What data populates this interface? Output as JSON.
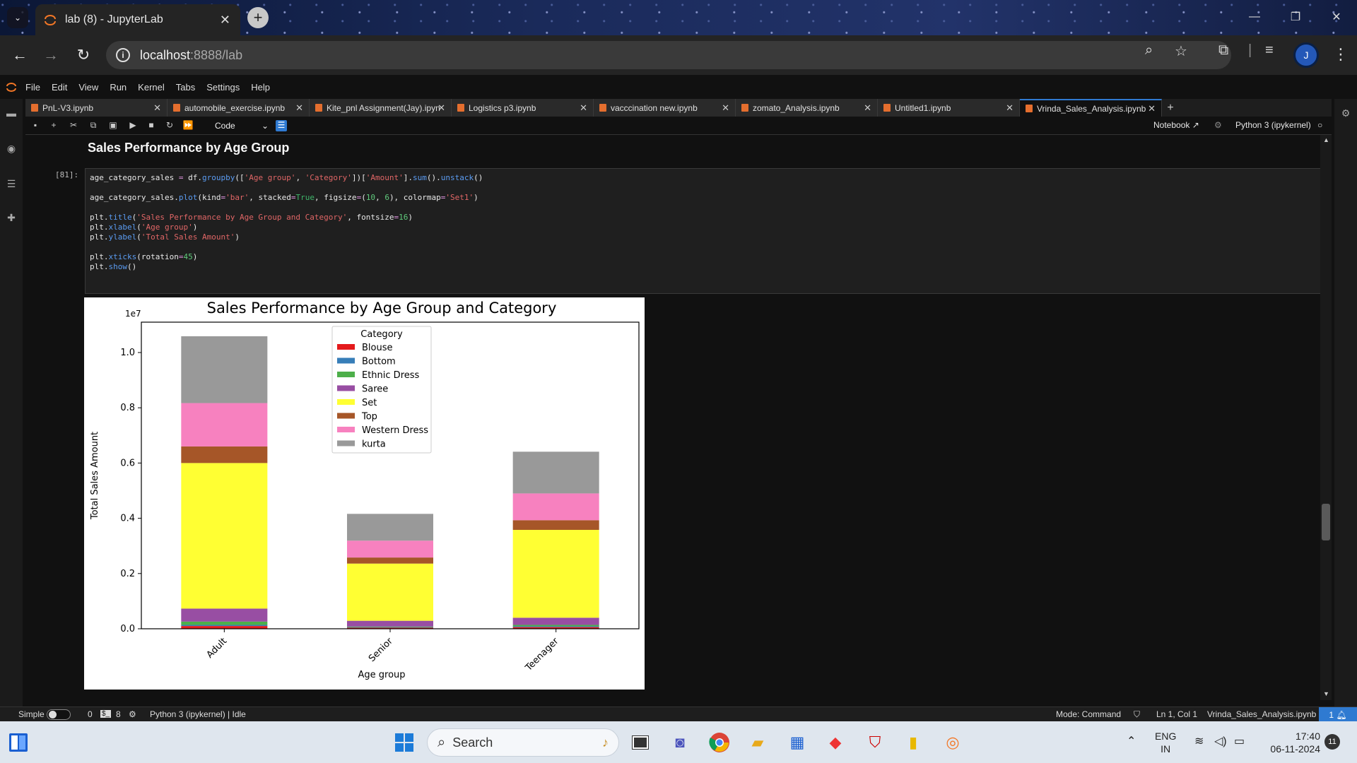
{
  "browser": {
    "tab_title": "lab (8) - JupyterLab",
    "url_host": "localhost",
    "url_path": ":8888/lab"
  },
  "menubar": [
    "File",
    "Edit",
    "View",
    "Run",
    "Kernel",
    "Tabs",
    "Settings",
    "Help"
  ],
  "notebook_tabs": [
    {
      "label": "PnL-V3.ipynb",
      "active": false
    },
    {
      "label": "automobile_exercise.ipynb",
      "active": false
    },
    {
      "label": "Kite_pnl Assignment(Jay).ipyn",
      "active": false
    },
    {
      "label": "Logistics p3.ipynb",
      "active": false
    },
    {
      "label": "vacccination new.ipynb",
      "active": false
    },
    {
      "label": "zomato_Analysis.ipynb",
      "active": false
    },
    {
      "label": "Untitled1.ipynb",
      "active": false
    },
    {
      "label": "Vrinda_Sales_Analysis.ipynb",
      "active": true
    }
  ],
  "toolbar": {
    "cell_type": "Code",
    "notebook_label": "Notebook",
    "kernel_label": "Python 3 (ipykernel)"
  },
  "notebook": {
    "heading": "Sales Performance by Age Group",
    "prompt": "[81]:"
  },
  "chart_data": {
    "type": "bar",
    "stacked": true,
    "title": "Sales Performance by Age Group and Category",
    "xlabel": "Age group",
    "ylabel": "Total Sales Amount",
    "scale_label": "1e7",
    "categories": [
      "Adult",
      "Senior",
      "Teenager"
    ],
    "ylim": [
      0,
      11100000
    ],
    "yticks": [
      0.0,
      0.2,
      0.4,
      0.6,
      0.8,
      1.0
    ],
    "legend_title": "Category",
    "legend_position": "upper center",
    "series": [
      {
        "name": "Blouse",
        "color": "#e41a1c",
        "values": [
          100000,
          40000,
          60000
        ]
      },
      {
        "name": "Bottom",
        "color": "#377eb8",
        "values": [
          40000,
          20000,
          30000
        ]
      },
      {
        "name": "Ethnic Dress",
        "color": "#4daf4a",
        "values": [
          120000,
          20000,
          50000
        ]
      },
      {
        "name": "Saree",
        "color": "#984ea3",
        "values": [
          470000,
          210000,
          260000
        ]
      },
      {
        "name": "Set",
        "color": "#ffff33",
        "values": [
          5270000,
          2070000,
          3180000
        ]
      },
      {
        "name": "Top",
        "color": "#a65628",
        "values": [
          600000,
          220000,
          350000
        ]
      },
      {
        "name": "Western Dress",
        "color": "#f781bf",
        "values": [
          1570000,
          610000,
          970000
        ]
      },
      {
        "name": "kurta",
        "color": "#999999",
        "values": [
          2420000,
          970000,
          1510000
        ]
      }
    ]
  },
  "statusbar": {
    "mode_label": "Simple",
    "zero": "0",
    "eight": "8",
    "kernel_status": "Python 3 (ipykernel) | Idle",
    "mode": "Mode: Command",
    "position": "Ln 1, Col 1",
    "filename": "Vrinda_Sales_Analysis.ipynb",
    "notif_count": "1"
  },
  "taskbar": {
    "search_placeholder": "Search",
    "lang_top": "ENG",
    "lang_bottom": "IN",
    "time": "17:40",
    "date": "06-11-2024",
    "notif_count": "11"
  }
}
